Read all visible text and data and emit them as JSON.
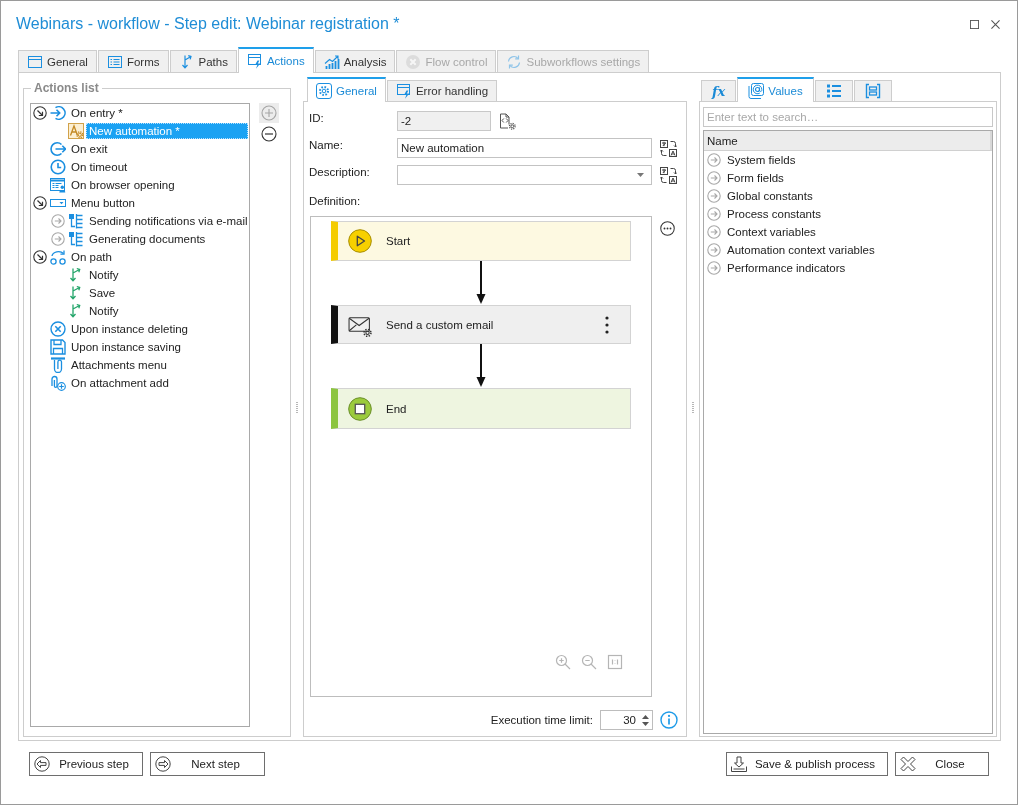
{
  "window": {
    "title": "Webinars - workflow - Step edit: Webinar registration *"
  },
  "tabs": [
    {
      "kind": "general",
      "label": "General",
      "selected": false,
      "disabled": false
    },
    {
      "kind": "forms",
      "label": "Forms",
      "selected": false,
      "disabled": false
    },
    {
      "kind": "paths",
      "label": "Paths",
      "selected": false,
      "disabled": false
    },
    {
      "kind": "actions",
      "label": "Actions",
      "selected": true,
      "disabled": false
    },
    {
      "kind": "analysis",
      "label": "Analysis",
      "selected": false,
      "disabled": false
    },
    {
      "kind": "flow_control",
      "label": "Flow control",
      "selected": false,
      "disabled": true
    },
    {
      "kind": "subworkflows",
      "label": "Subworkflows settings",
      "selected": false,
      "disabled": true
    }
  ],
  "actions_panel": {
    "title": "Actions list",
    "tree": [
      {
        "kind": "entry",
        "label": "On entry *",
        "expanded": true,
        "selected": false,
        "children": [
          {
            "kind": "automation",
            "label": "New automation *",
            "selected": true
          }
        ]
      },
      {
        "kind": "exit",
        "label": "On exit",
        "selected": false
      },
      {
        "kind": "timeout",
        "label": "On timeout",
        "selected": false
      },
      {
        "kind": "browser",
        "label": "On browser opening",
        "selected": false
      },
      {
        "kind": "menu",
        "label": "Menu button",
        "expanded": true,
        "selected": false,
        "children": [
          {
            "kind": "action",
            "label": "Sending notifications via e-mail",
            "expanded": false,
            "selected": false
          },
          {
            "kind": "action",
            "label": "Generating documents",
            "expanded": false,
            "selected": false
          }
        ]
      },
      {
        "kind": "path",
        "label": "On path",
        "expanded": true,
        "selected": false,
        "children": [
          {
            "kind": "transition",
            "label": "Notify",
            "selected": false
          },
          {
            "kind": "transition",
            "label": "Save",
            "selected": false
          },
          {
            "kind": "transition",
            "label": "Notify",
            "selected": false
          }
        ]
      },
      {
        "kind": "delete",
        "label": "Upon instance deleting",
        "selected": false
      },
      {
        "kind": "save",
        "label": "Upon instance saving",
        "selected": false
      },
      {
        "kind": "attachments",
        "label": "Attachments menu",
        "selected": false
      },
      {
        "kind": "attachment_add",
        "label": "On attachment add",
        "selected": false
      }
    ],
    "buttons": [
      {
        "kind": "add",
        "disabled": true
      },
      {
        "kind": "remove",
        "disabled": false
      }
    ]
  },
  "action_editor": {
    "tabs": [
      {
        "kind": "general",
        "label": "General",
        "selected": true
      },
      {
        "kind": "error_handling",
        "label": "Error handling",
        "selected": false
      }
    ],
    "fields": [
      {
        "kind": "readonly",
        "label": "ID:",
        "value": "-2"
      },
      {
        "kind": "text",
        "label": "Name:",
        "value": "New automation"
      },
      {
        "kind": "dropdown",
        "label": "Description:"
      }
    ],
    "definition": {
      "label": "Definition:",
      "nodes": [
        {
          "kind": "start",
          "label": "Start"
        },
        {
          "kind": "action",
          "label": "Send a custom email"
        },
        {
          "kind": "end",
          "label": "End"
        }
      ]
    },
    "execution_time_limit": {
      "label": "Execution time limit:",
      "value": "30"
    }
  },
  "values_panel": {
    "tabs": [
      {
        "kind": "functions",
        "label": "fx",
        "selected": false
      },
      {
        "kind": "values",
        "label": "Values",
        "selected": true
      },
      {
        "kind": "list",
        "selected": false
      },
      {
        "kind": "structure",
        "selected": false
      }
    ],
    "search": {
      "placeholder": "Enter text to search…"
    },
    "columns": [
      "Name"
    ],
    "rows": [
      {
        "label": "System fields",
        "expanded": false
      },
      {
        "label": "Form fields",
        "expanded": false
      },
      {
        "label": "Global constants",
        "expanded": false
      },
      {
        "label": "Process constants",
        "expanded": false
      },
      {
        "label": "Context variables",
        "expanded": false
      },
      {
        "label": "Automation context variables",
        "expanded": false
      },
      {
        "label": "Performance indicators",
        "expanded": false
      }
    ]
  },
  "footer": {
    "left_buttons": [
      {
        "kind": "previous",
        "label": "Previous step"
      },
      {
        "kind": "next",
        "label": "Next step"
      }
    ],
    "right_buttons": [
      {
        "kind": "publish",
        "label": "Save & publish process"
      },
      {
        "kind": "close",
        "label": "Close"
      }
    ]
  }
}
